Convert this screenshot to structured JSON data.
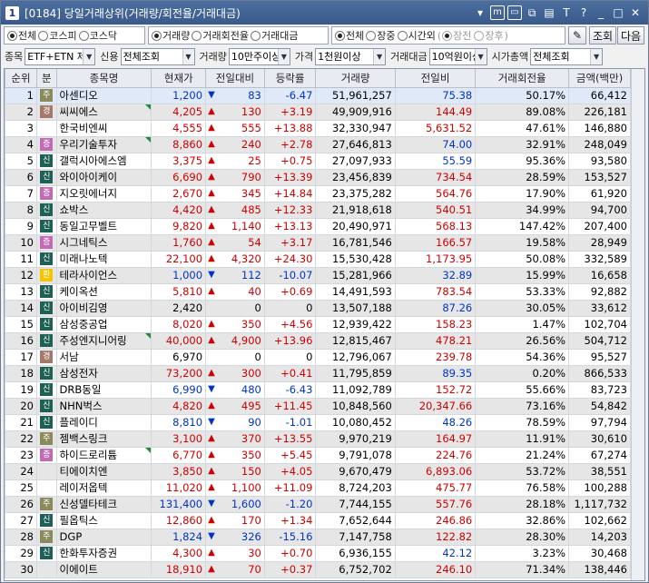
{
  "window": {
    "number": "1",
    "title": "[0184] 당일거래상위(거래량/회전율/거래대금)",
    "icons": [
      "dropdown-icon",
      "memo-icon",
      "window-icon",
      "link-icon",
      "print-icon",
      "text-icon",
      "help-icon",
      "minimize-icon",
      "maximize-icon",
      "close-icon"
    ]
  },
  "filters": {
    "market": [
      "전체",
      "코스피",
      "코스닥"
    ],
    "market_selected": 0,
    "sort": [
      "거래량",
      "거래회전율",
      "거래대금"
    ],
    "sort_selected": 0,
    "session": [
      "전체",
      "장중",
      "시간외"
    ],
    "session_selected": 0,
    "sub_session": [
      "장전",
      "장후"
    ],
    "query_button": "조회",
    "next_button": "다음"
  },
  "conditions": {
    "stock_label": "종목",
    "stock_value": "ETF+ETN 제",
    "credit_label": "신용",
    "credit_value": "전체조회",
    "volume_label": "거래량",
    "volume_value": "10만주이상",
    "price_label": "가격",
    "price_value": "1천원이상",
    "amount_label": "거래대금",
    "amount_value": "10억원이상",
    "cap_label": "시가총액",
    "cap_value": "전체조회"
  },
  "columns": [
    "순위",
    "분",
    "종목명",
    "현재가",
    "전일대비",
    "등락률",
    "거래량",
    "전일비",
    "거래회전율",
    "금액(백만)"
  ],
  "badge_colors": {
    "증": "#c06bb4",
    "경": "#a4786a",
    "신": "#1e5f56",
    "주": "#8a8a5c",
    "환": "#f5c400"
  },
  "rows": [
    {
      "rank": "1",
      "badge": "주",
      "name": "아센디오",
      "price": "1,200",
      "dir": "dn",
      "change": "83",
      "rate": "-6.47",
      "volume": "51,961,257",
      "prev": "75.38",
      "prev_dir": "dn",
      "turnover": "50.17%",
      "amount": "66,412",
      "mark": false
    },
    {
      "rank": "2",
      "badge": "경",
      "name": "씨씨에스",
      "price": "4,205",
      "dir": "up",
      "change": "130",
      "rate": "+3.19",
      "volume": "49,909,916",
      "prev": "144.49",
      "prev_dir": "up",
      "turnover": "89.08%",
      "amount": "226,181",
      "mark": true
    },
    {
      "rank": "3",
      "badge": "",
      "name": "한국비엔씨",
      "price": "4,555",
      "dir": "up",
      "change": "555",
      "rate": "+13.88",
      "volume": "32,330,947",
      "prev": "5,631.52",
      "prev_dir": "up",
      "turnover": "47.61%",
      "amount": "146,880",
      "mark": false
    },
    {
      "rank": "4",
      "badge": "증",
      "name": "우리기술투자",
      "price": "8,860",
      "dir": "up",
      "change": "240",
      "rate": "+2.78",
      "volume": "27,646,813",
      "prev": "74.00",
      "prev_dir": "dn",
      "turnover": "32.91%",
      "amount": "248,049",
      "mark": true
    },
    {
      "rank": "5",
      "badge": "신",
      "name": "갤럭시아에스엠",
      "price": "3,375",
      "dir": "up",
      "change": "25",
      "rate": "+0.75",
      "volume": "27,097,933",
      "prev": "55.59",
      "prev_dir": "dn",
      "turnover": "95.36%",
      "amount": "93,580",
      "mark": false
    },
    {
      "rank": "6",
      "badge": "신",
      "name": "와이아이케이",
      "price": "6,690",
      "dir": "up",
      "change": "790",
      "rate": "+13.39",
      "volume": "23,456,839",
      "prev": "734.54",
      "prev_dir": "up",
      "turnover": "28.59%",
      "amount": "153,527",
      "mark": false
    },
    {
      "rank": "7",
      "badge": "증",
      "name": "지오릿에너지",
      "price": "2,670",
      "dir": "up",
      "change": "345",
      "rate": "+14.84",
      "volume": "23,375,282",
      "prev": "564.76",
      "prev_dir": "up",
      "turnover": "17.90%",
      "amount": "61,920",
      "mark": false
    },
    {
      "rank": "8",
      "badge": "신",
      "name": "쇼박스",
      "price": "4,420",
      "dir": "up",
      "change": "485",
      "rate": "+12.33",
      "volume": "21,918,618",
      "prev": "540.51",
      "prev_dir": "up",
      "turnover": "34.99%",
      "amount": "94,700",
      "mark": false
    },
    {
      "rank": "9",
      "badge": "신",
      "name": "동일고무벨트",
      "price": "9,820",
      "dir": "up",
      "change": "1,140",
      "rate": "+13.13",
      "volume": "20,490,971",
      "prev": "568.13",
      "prev_dir": "up",
      "turnover": "147.42%",
      "amount": "207,400",
      "mark": false
    },
    {
      "rank": "10",
      "badge": "증",
      "name": "시그네틱스",
      "price": "1,760",
      "dir": "up",
      "change": "54",
      "rate": "+3.17",
      "volume": "16,781,546",
      "prev": "166.57",
      "prev_dir": "up",
      "turnover": "19.58%",
      "amount": "28,949",
      "mark": false
    },
    {
      "rank": "11",
      "badge": "신",
      "name": "미래나노텍",
      "price": "22,100",
      "dir": "up",
      "change": "4,320",
      "rate": "+24.30",
      "volume": "15,530,428",
      "prev": "1,173.95",
      "prev_dir": "up",
      "turnover": "50.08%",
      "amount": "332,589",
      "mark": false
    },
    {
      "rank": "12",
      "badge": "환",
      "name": "테라사이언스",
      "price": "1,000",
      "dir": "dn",
      "change": "112",
      "rate": "-10.07",
      "volume": "15,281,966",
      "prev": "32.89",
      "prev_dir": "dn",
      "turnover": "15.99%",
      "amount": "16,658",
      "mark": false
    },
    {
      "rank": "13",
      "badge": "신",
      "name": "케이옥션",
      "price": "5,810",
      "dir": "up",
      "change": "40",
      "rate": "+0.69",
      "volume": "14,491,593",
      "prev": "783.54",
      "prev_dir": "up",
      "turnover": "53.33%",
      "amount": "92,882",
      "mark": false
    },
    {
      "rank": "14",
      "badge": "신",
      "name": "아이비김영",
      "price": "2,420",
      "dir": "eq",
      "change": "0",
      "rate": "0",
      "volume": "13,507,188",
      "prev": "87.26",
      "prev_dir": "dn",
      "turnover": "30.05%",
      "amount": "33,612",
      "mark": false
    },
    {
      "rank": "15",
      "badge": "신",
      "name": "삼성중공업",
      "price": "8,020",
      "dir": "up",
      "change": "350",
      "rate": "+4.56",
      "volume": "12,939,422",
      "prev": "158.23",
      "prev_dir": "up",
      "turnover": "1.47%",
      "amount": "102,704",
      "mark": false
    },
    {
      "rank": "16",
      "badge": "신",
      "name": "주성엔지니어링",
      "price": "40,000",
      "dir": "up",
      "change": "4,900",
      "rate": "+13.96",
      "volume": "12,815,467",
      "prev": "478.21",
      "prev_dir": "up",
      "turnover": "26.56%",
      "amount": "504,712",
      "mark": true
    },
    {
      "rank": "17",
      "badge": "경",
      "name": "서남",
      "price": "6,970",
      "dir": "eq",
      "change": "0",
      "rate": "0",
      "volume": "12,796,067",
      "prev": "239.78",
      "prev_dir": "up",
      "turnover": "54.36%",
      "amount": "95,527",
      "mark": false
    },
    {
      "rank": "18",
      "badge": "신",
      "name": "삼성전자",
      "price": "73,200",
      "dir": "up",
      "change": "300",
      "rate": "+0.41",
      "volume": "11,795,859",
      "prev": "89.35",
      "prev_dir": "dn",
      "turnover": "0.20%",
      "amount": "866,533",
      "mark": false
    },
    {
      "rank": "19",
      "badge": "신",
      "name": "DRB동일",
      "price": "6,990",
      "dir": "dn",
      "change": "480",
      "rate": "-6.43",
      "volume": "11,092,789",
      "prev": "152.72",
      "prev_dir": "up",
      "turnover": "55.66%",
      "amount": "83,723",
      "mark": false
    },
    {
      "rank": "20",
      "badge": "신",
      "name": "NHN벅스",
      "price": "4,820",
      "dir": "up",
      "change": "495",
      "rate": "+11.45",
      "volume": "10,848,560",
      "prev": "20,347.66",
      "prev_dir": "up",
      "turnover": "73.16%",
      "amount": "54,842",
      "mark": false
    },
    {
      "rank": "21",
      "badge": "신",
      "name": "플레이디",
      "price": "8,810",
      "dir": "dn",
      "change": "90",
      "rate": "-1.01",
      "volume": "10,080,452",
      "prev": "48.26",
      "prev_dir": "dn",
      "turnover": "78.59%",
      "amount": "97,794",
      "mark": false
    },
    {
      "rank": "22",
      "badge": "주",
      "name": "젬백스링크",
      "price": "3,100",
      "dir": "up",
      "change": "370",
      "rate": "+13.55",
      "volume": "9,970,219",
      "prev": "164.97",
      "prev_dir": "up",
      "turnover": "11.91%",
      "amount": "30,610",
      "mark": false
    },
    {
      "rank": "23",
      "badge": "증",
      "name": "하이드로리튬",
      "price": "6,770",
      "dir": "up",
      "change": "350",
      "rate": "+5.45",
      "volume": "9,791,078",
      "prev": "224.76",
      "prev_dir": "up",
      "turnover": "21.24%",
      "amount": "67,274",
      "mark": true
    },
    {
      "rank": "24",
      "badge": "",
      "name": "티에이치엔",
      "price": "3,850",
      "dir": "up",
      "change": "150",
      "rate": "+4.05",
      "volume": "9,670,479",
      "prev": "6,893.06",
      "prev_dir": "up",
      "turnover": "53.72%",
      "amount": "38,551",
      "mark": false
    },
    {
      "rank": "25",
      "badge": "",
      "name": "레이저옵텍",
      "price": "11,020",
      "dir": "up",
      "change": "1,100",
      "rate": "+11.09",
      "volume": "8,724,203",
      "prev": "475.77",
      "prev_dir": "up",
      "turnover": "76.58%",
      "amount": "100,288",
      "mark": false
    },
    {
      "rank": "26",
      "badge": "주",
      "name": "신성델타테크",
      "price": "131,400",
      "dir": "dn",
      "change": "1,600",
      "rate": "-1.20",
      "volume": "7,744,155",
      "prev": "557.76",
      "prev_dir": "up",
      "turnover": "28.18%",
      "amount": "1,117,732",
      "mark": false
    },
    {
      "rank": "27",
      "badge": "신",
      "name": "필옵틱스",
      "price": "12,860",
      "dir": "up",
      "change": "170",
      "rate": "+1.34",
      "volume": "7,652,644",
      "prev": "246.86",
      "prev_dir": "up",
      "turnover": "32.86%",
      "amount": "102,662",
      "mark": false
    },
    {
      "rank": "28",
      "badge": "주",
      "name": "DGP",
      "price": "1,824",
      "dir": "dn",
      "change": "326",
      "rate": "-15.16",
      "volume": "7,147,758",
      "prev": "122.82",
      "prev_dir": "up",
      "turnover": "28.30%",
      "amount": "14,203",
      "mark": false
    },
    {
      "rank": "29",
      "badge": "신",
      "name": "한화투자증권",
      "price": "4,300",
      "dir": "up",
      "change": "30",
      "rate": "+0.70",
      "volume": "6,936,155",
      "prev": "42.12",
      "prev_dir": "dn",
      "turnover": "3.23%",
      "amount": "30,468",
      "mark": false
    },
    {
      "rank": "30",
      "badge": "",
      "name": "이에이트",
      "price": "18,910",
      "dir": "up",
      "change": "70",
      "rate": "+0.37",
      "volume": "6,752,702",
      "prev": "246.10",
      "prev_dir": "up",
      "turnover": "71.34%",
      "amount": "138,446",
      "mark": false
    }
  ]
}
